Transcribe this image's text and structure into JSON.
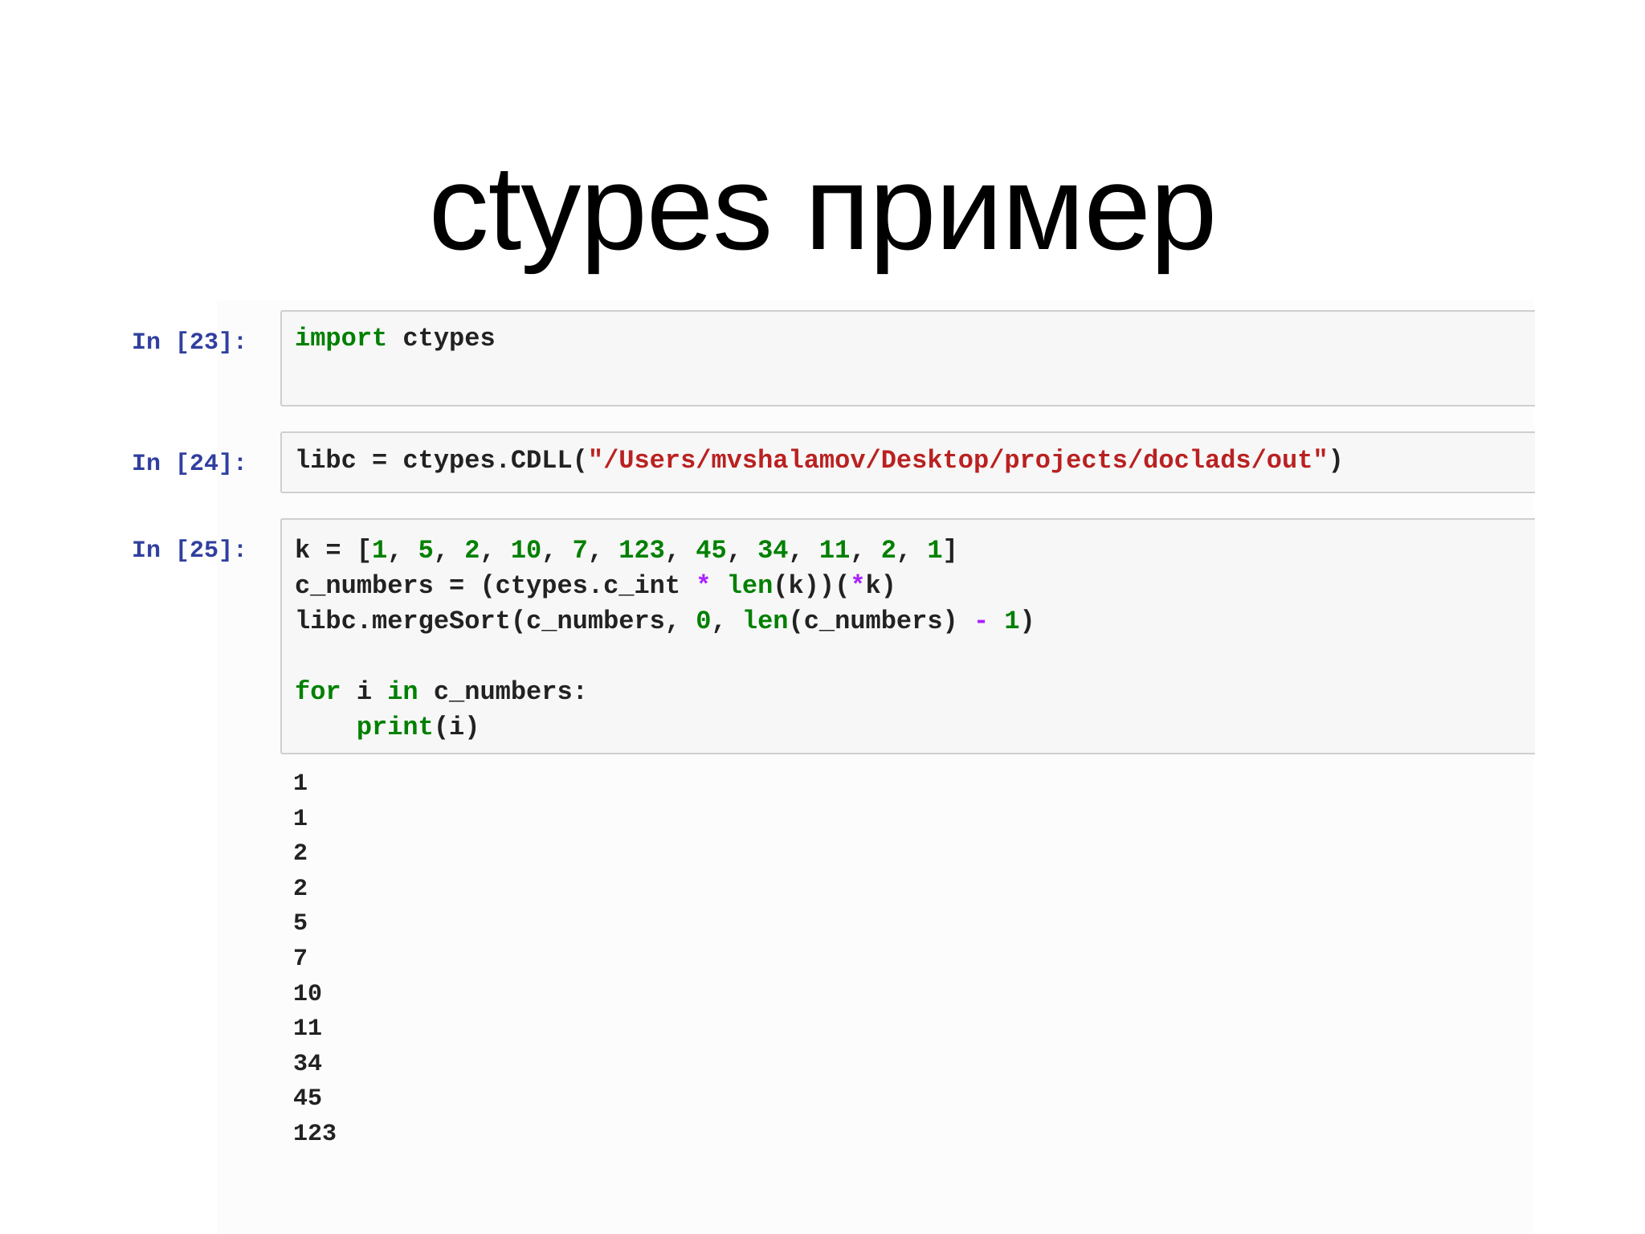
{
  "slide": {
    "title": "ctypes пример"
  },
  "cells": [
    {
      "prompt": "In [23]:",
      "code": [
        "import",
        " ctypes"
      ]
    },
    {
      "prompt": "In [24]:",
      "code": [
        "libc = ctypes.CDLL(",
        "\"/Users/mvshalamov/Desktop/projects/doclads/out\"",
        ")"
      ]
    },
    {
      "prompt": "In [25]:",
      "code": {
        "line1": [
          "k = [",
          "1",
          ", ",
          "5",
          ", ",
          "2",
          ", ",
          "10",
          ", ",
          "7",
          ", ",
          "123",
          ", ",
          "45",
          ", ",
          "34",
          ", ",
          "11",
          ", ",
          "2",
          ", ",
          "1",
          "]"
        ],
        "line2": [
          "c_numbers = (ctypes.c_int ",
          "*",
          " ",
          "len",
          "(k))(",
          "*",
          "k)"
        ],
        "line3": [
          "libc.mergeSort(c_numbers, ",
          "0",
          ", ",
          "len",
          "(c_numbers) ",
          "-",
          " ",
          "1",
          ")"
        ],
        "line5": [
          "for",
          " i ",
          "in",
          " c_numbers:"
        ],
        "line6": [
          "    ",
          "print",
          "(i)"
        ]
      },
      "output": [
        "1",
        "1",
        "2",
        "2",
        "5",
        "7",
        "10",
        "11",
        "34",
        "45",
        "123"
      ]
    }
  ],
  "colors": {
    "prompt": "#303f9f",
    "keyword": "#008000",
    "number": "#008000",
    "string": "#ba2121",
    "operator": "#aa22ff",
    "cell_background": "#f7f7f7",
    "cell_border": "#cfcfcf"
  }
}
